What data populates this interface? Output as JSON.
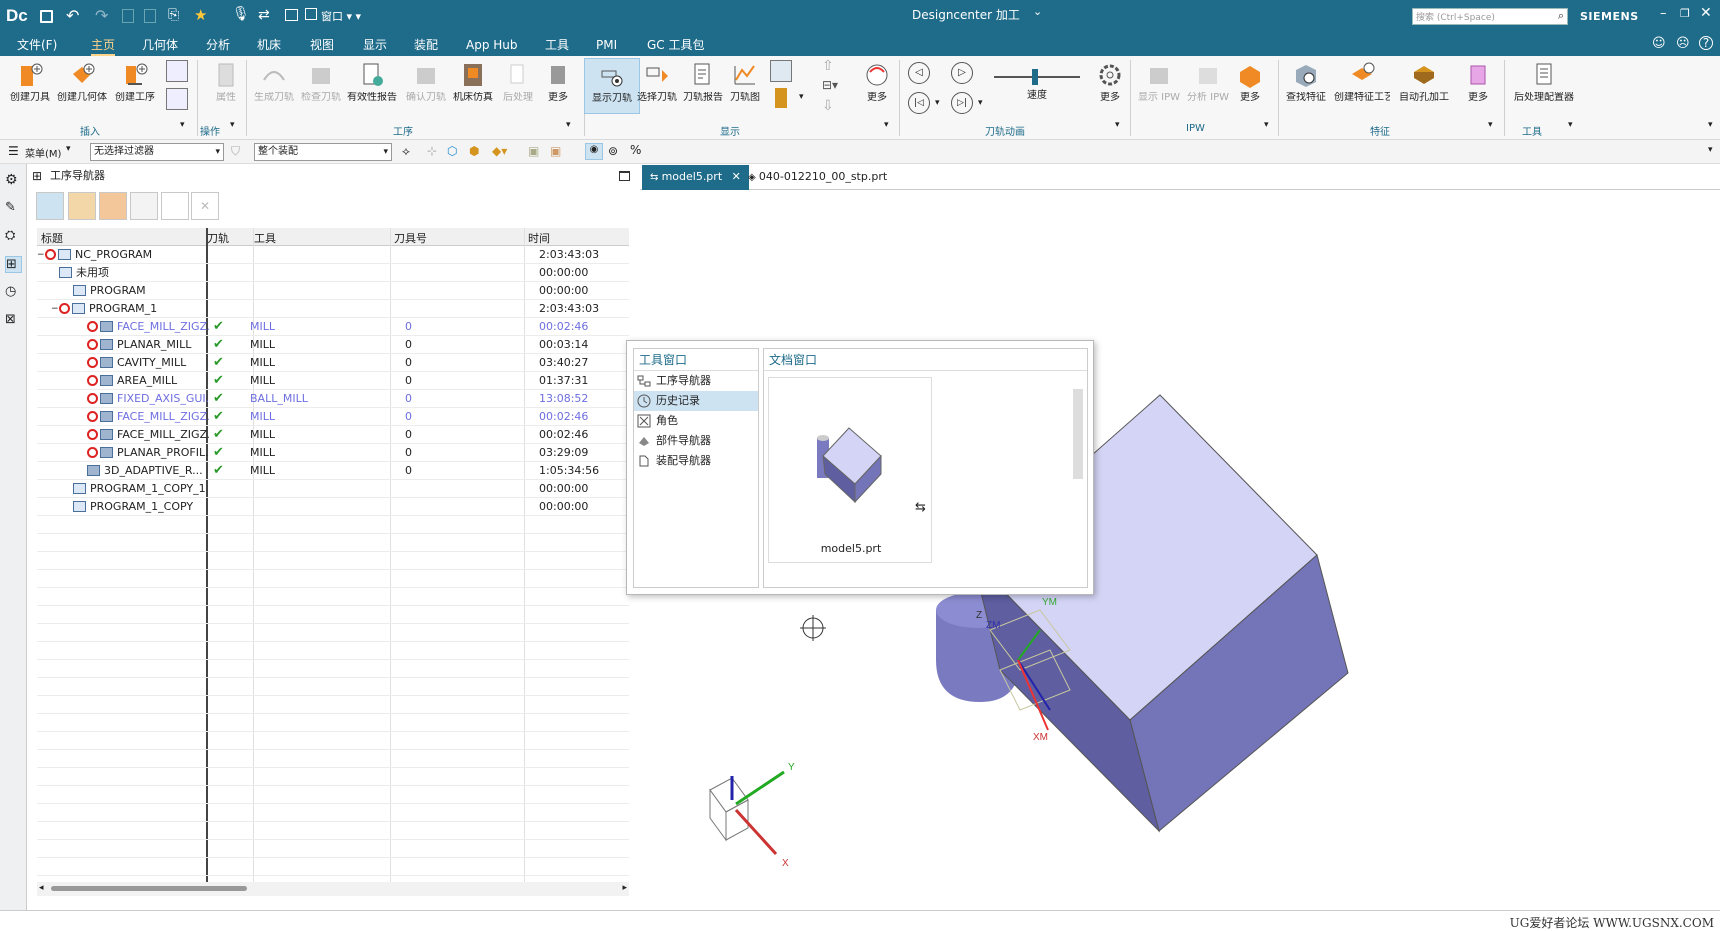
{
  "titlebar": {
    "app_logo": "Dc",
    "window_title": "Designcenter 加工",
    "search_placeholder": "搜索 (Ctrl+Space)",
    "brand": "SIEMENS",
    "accent": "#1e6b8a"
  },
  "menu": [
    "文件(F)",
    "主页",
    "几何体",
    "分析",
    "机床",
    "视图",
    "显示",
    "装配",
    "App Hub",
    "工具",
    "PMI",
    "GC 工具包"
  ],
  "ribbon": {
    "groups": [
      "插入",
      "操作",
      "工序",
      "显示",
      "刀轨动画",
      "IPW",
      "特征",
      "工具"
    ],
    "buttons": [
      "创建刀具",
      "创建几何体",
      "创建工序",
      "属性",
      "生成刀轨",
      "检查刀轨",
      "有效性报告",
      "确认刀轨",
      "机床仿真",
      "后处理",
      "更多",
      "显示刀轨",
      "选择刀轨",
      "刀轨报告",
      "刀轨图",
      "更多",
      "速度",
      "更多",
      "显示 IPW",
      "分析 IPW",
      "更多",
      "查找特征",
      "创建特征工艺",
      "自动孔加工",
      "更多",
      "后处理配置器"
    ]
  },
  "selection_bar": {
    "menu": "菜单(M)",
    "filter": "无选择过滤器",
    "scope": "整个装配"
  },
  "navigator": {
    "title": "工序导航器",
    "columns": [
      "标题",
      "刀轨",
      "工具",
      "刀具号",
      "时间"
    ],
    "rows": [
      {
        "name": "NC_PROGRAM",
        "path": "",
        "tool": "",
        "num": "",
        "time": "2:03:43:03"
      },
      {
        "name": "未用项",
        "path": "",
        "tool": "",
        "num": "",
        "time": "00:00:00"
      },
      {
        "name": "PROGRAM",
        "path": "",
        "tool": "",
        "num": "",
        "time": "00:00:00"
      },
      {
        "name": "PROGRAM_1",
        "path": "",
        "tool": "",
        "num": "",
        "time": "2:03:43:03"
      },
      {
        "name": "FACE_MILL_ZIGZ...",
        "path": "✔",
        "tool": "MILL",
        "num": "0",
        "time": "00:02:46"
      },
      {
        "name": "PLANAR_MILL",
        "path": "✔",
        "tool": "MILL",
        "num": "0",
        "time": "00:03:14"
      },
      {
        "name": "CAVITY_MILL",
        "path": "✔",
        "tool": "MILL",
        "num": "0",
        "time": "03:40:27"
      },
      {
        "name": "AREA_MILL",
        "path": "✔",
        "tool": "MILL",
        "num": "0",
        "time": "01:37:31"
      },
      {
        "name": "FIXED_AXIS_GUI...",
        "path": "✔",
        "tool": "BALL_MILL",
        "num": "0",
        "time": "13:08:52"
      },
      {
        "name": "FACE_MILL_ZIGZ...",
        "path": "✔",
        "tool": "MILL",
        "num": "0",
        "time": "00:02:46"
      },
      {
        "name": "FACE_MILL_ZIGZ...",
        "path": "✔",
        "tool": "MILL",
        "num": "0",
        "time": "00:02:46"
      },
      {
        "name": "PLANAR_PROFIL...",
        "path": "✔",
        "tool": "MILL",
        "num": "0",
        "time": "03:29:09"
      },
      {
        "name": "3D_ADAPTIVE_R...",
        "path": "✔",
        "tool": "MILL",
        "num": "0",
        "time": "1:05:34:56"
      },
      {
        "name": "PROGRAM_1_COPY_1",
        "path": "",
        "tool": "",
        "num": "",
        "time": "00:00:00"
      },
      {
        "name": "PROGRAM_1_COPY",
        "path": "",
        "tool": "",
        "num": "",
        "time": "00:00:00"
      }
    ]
  },
  "doc_tabs": [
    "model5.prt",
    "040-012210_00_stp.prt"
  ],
  "popup": {
    "tool_windows_title": "工具窗口",
    "doc_windows_title": "文档窗口",
    "tool_items": [
      "工序导航器",
      "历史记录",
      "角色",
      "部件导航器",
      "装配导航器"
    ],
    "doc_item": "model5.prt"
  },
  "viewport_labels": {
    "ym": "YM",
    "zm": "ZM",
    "xm": "XM",
    "z": "Z",
    "x": "X",
    "y": "Y"
  },
  "watermark": "UG爱好者论坛  WWW.UGSNX.COM"
}
